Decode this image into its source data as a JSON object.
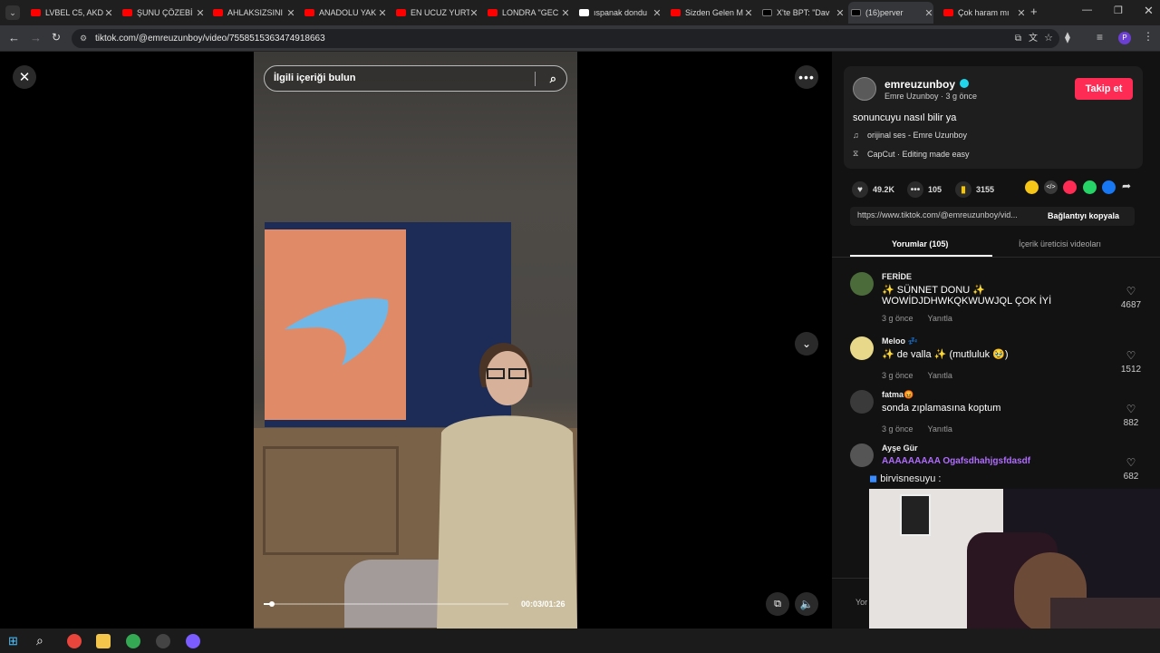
{
  "browser": {
    "tabs": [
      {
        "label": "LVBEL C5, AKD",
        "color": "#ff0000"
      },
      {
        "label": "ŞUNU ÇÖZEBİ",
        "color": "#ff0000"
      },
      {
        "label": "AHLAKSIZSINI",
        "color": "#ff0000"
      },
      {
        "label": "ANADOLU YAK",
        "color": "#ff0000"
      },
      {
        "label": "EN UCUZ YURT",
        "color": "#ff0000"
      },
      {
        "label": "LONDRA \"GEC",
        "color": "#ff0000"
      },
      {
        "label": "ıspanak dondu",
        "color": "#ffffff"
      },
      {
        "label": "Sizden Gelen M",
        "color": "#ff0000"
      },
      {
        "label": "X'te BPT: \"Dav",
        "color": "#000000"
      },
      {
        "label": "(16)perver",
        "color": "#000000"
      },
      {
        "label": "Çok haram mı",
        "color": "#ff0000"
      }
    ],
    "url": "tiktok.com/@emreuzunboy/video/7558515363474918663"
  },
  "video": {
    "search_placeholder": "İlgili içeriği bulun",
    "progress": 0.035,
    "timecode": "00:03/01:26"
  },
  "creator": {
    "username": "emreuzunboy",
    "display": "Emre Uzunboy · 3 g önce",
    "follow_label": "Takip et",
    "description": "sonuncuyu nasıl bilir ya",
    "music": "orijinal ses - Emre Uzunboy",
    "capcut": "CapCut · Editing made easy"
  },
  "stats": {
    "likes": "49.2K",
    "comments": "105",
    "saves": "3155"
  },
  "link": {
    "url": "https://www.tiktok.com/@emreuzunboy/vid...",
    "copy_label": "Bağlantıyı kopyala"
  },
  "panel_tabs": {
    "comments": "Yorumlar (105)",
    "creator_videos": "İçerik üreticisi videoları"
  },
  "comments": [
    {
      "name": "FERİDE",
      "text": "✨ SÜNNET DONU ✨ WOWİDJDHWKQKWUWJQL ÇOK İYİ",
      "time": "3 g önce",
      "reply": "Yanıtla",
      "likes": "4687",
      "avatar_color": "#4b6b3a"
    },
    {
      "name": "Meloo 💤",
      "text": "✨ de valla ✨ (mutluluk 🥹)",
      "time": "3 g önce",
      "reply": "Yanıtla",
      "likes": "1512",
      "avatar_color": "#e8d98a"
    },
    {
      "name": "fatma😡",
      "text": "sonda zıplamasına koptum",
      "time": "3 g önce",
      "reply": "Yanıtla",
      "likes": "882",
      "avatar_color": "#3a3a3a"
    },
    {
      "name": "Ayşe Gür",
      "text": "",
      "time": "",
      "reply": "",
      "likes": "682",
      "avatar_color": "#555555"
    }
  ],
  "comment_input": "Yor",
  "stream": {
    "chat_overlay": "AAAAAAAAA Ogafsdhahjgsfdasdf",
    "chat_line": "birvisnesuyu :"
  }
}
